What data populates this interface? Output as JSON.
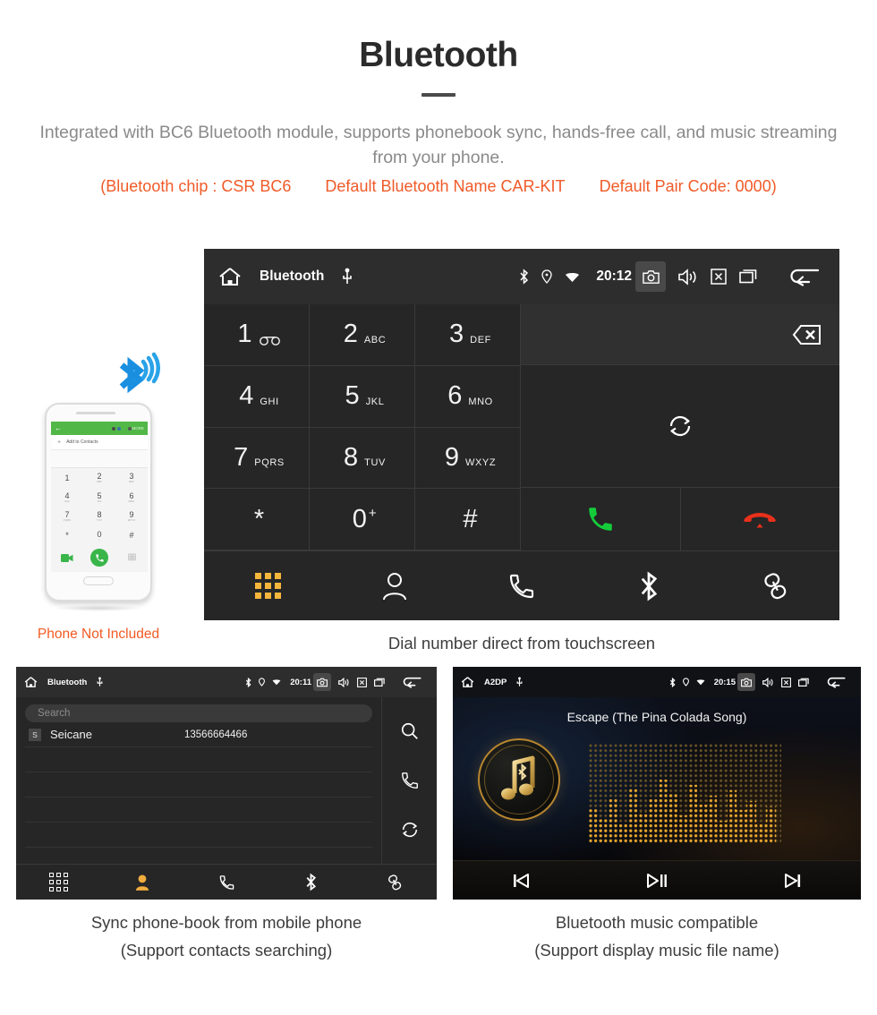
{
  "header": {
    "title": "Bluetooth",
    "subtitle": "Integrated with BC6 Bluetooth module, supports phonebook sync, hands-free call, and music streaming from your phone.",
    "spec_chip": "(Bluetooth chip : CSR BC6",
    "spec_name": "Default Bluetooth Name CAR-KIT",
    "spec_pair": "Default Pair Code: 0000)",
    "accent_color": "#f05a28"
  },
  "main_unit": {
    "statusbar": {
      "home_icon": "home-icon",
      "title": "Bluetooth",
      "usb_icon": "usb-icon",
      "bluetooth_icon": "bluetooth-icon",
      "location_icon": "location-icon",
      "wifi_icon": "wifi-icon",
      "time": "20:12",
      "camera_icon": "camera-icon",
      "volume_icon": "volume-icon",
      "close_icon": "close-box-icon",
      "recents_icon": "recents-icon",
      "back_icon": "back-arrow-icon"
    },
    "keys": [
      {
        "num": "1",
        "sub": "",
        "voicemail": true
      },
      {
        "num": "2",
        "sub": "ABC"
      },
      {
        "num": "3",
        "sub": "DEF"
      },
      {
        "num": "4",
        "sub": "GHI"
      },
      {
        "num": "5",
        "sub": "JKL"
      },
      {
        "num": "6",
        "sub": "MNO"
      },
      {
        "num": "7",
        "sub": "PQRS"
      },
      {
        "num": "8",
        "sub": "TUV"
      },
      {
        "num": "9",
        "sub": "WXYZ"
      },
      {
        "num": "*",
        "sub": ""
      },
      {
        "num": "0",
        "sub": "+",
        "sup": true
      },
      {
        "num": "#",
        "sub": ""
      }
    ],
    "input_value": "",
    "backspace_icon": "backspace-icon",
    "sync_icon": "sync-icon",
    "call_icon": "call-green-icon",
    "hangup_icon": "hangup-red-icon",
    "tabs": [
      {
        "icon": "keypad-icon",
        "active": true
      },
      {
        "icon": "contacts-icon",
        "active": false
      },
      {
        "icon": "call-history-icon",
        "active": false
      },
      {
        "icon": "bluetooth-icon",
        "active": false
      },
      {
        "icon": "pair-link-icon",
        "active": false
      }
    ],
    "caption": "Dial number direct from touchscreen"
  },
  "phone_mock": {
    "bluetooth_badge_icon": "bluetooth-signal-icon",
    "app_back_icon": "back-arrow-icon",
    "app_more_label": "MORE",
    "add_contact_label": "Add to Contacts",
    "keys": [
      {
        "num": "1",
        "sub": ""
      },
      {
        "num": "2",
        "sub": "ABC"
      },
      {
        "num": "3",
        "sub": "DEF"
      },
      {
        "num": "4",
        "sub": "GHI"
      },
      {
        "num": "5",
        "sub": "JKL"
      },
      {
        "num": "6",
        "sub": "MNO"
      },
      {
        "num": "7",
        "sub": "PQRS"
      },
      {
        "num": "8",
        "sub": "TUV"
      },
      {
        "num": "9",
        "sub": "WXYZ"
      },
      {
        "num": "*",
        "sub": ""
      },
      {
        "num": "0",
        "sub": "+"
      },
      {
        "num": "#",
        "sub": ""
      }
    ],
    "video_call_icon": "video-call-icon",
    "call_icon": "call-green-icon",
    "keypad_toggle_icon": "keypad-icon",
    "disclaimer": "Phone Not Included",
    "disclaimer_color": "#f15a22"
  },
  "contacts_unit": {
    "statusbar": {
      "home_icon": "home-icon",
      "title": "Bluetooth",
      "usb_icon": "usb-icon",
      "time": "20:11",
      "camera_icon": "camera-icon",
      "volume_icon": "volume-icon",
      "close_icon": "close-box-icon",
      "recents_icon": "recents-icon",
      "back_icon": "back-arrow-icon"
    },
    "search_placeholder": "Search",
    "contacts": [
      {
        "initial": "S",
        "name": "Seicane",
        "number": "13566664466"
      }
    ],
    "empty_rows": 4,
    "side_actions": [
      {
        "icon": "search-icon"
      },
      {
        "icon": "call-icon"
      },
      {
        "icon": "sync-icon"
      }
    ],
    "tabs": [
      {
        "icon": "keypad-icon",
        "active": false
      },
      {
        "icon": "contacts-icon",
        "active": true
      },
      {
        "icon": "call-history-icon",
        "active": false
      },
      {
        "icon": "bluetooth-icon",
        "active": false
      },
      {
        "icon": "pair-link-icon",
        "active": false
      }
    ],
    "caption_line1": "Sync phone-book from mobile phone",
    "caption_line2": "(Support contacts searching)"
  },
  "music_unit": {
    "statusbar": {
      "home_icon": "home-icon",
      "title": "A2DP",
      "usb_icon": "usb-icon",
      "time": "20:15",
      "camera_icon": "camera-icon",
      "volume_icon": "volume-icon",
      "close_icon": "close-box-icon",
      "recents_icon": "recents-icon",
      "back_icon": "back-arrow-icon"
    },
    "song_title": "Escape (The Pina Colada Song)",
    "album_icon": "bluetooth-music-note-icon",
    "equalizer_icon": "dot-matrix-equalizer",
    "controls": [
      {
        "icon": "previous-track-icon"
      },
      {
        "icon": "play-pause-icon"
      },
      {
        "icon": "next-track-icon"
      }
    ],
    "caption_line1": "Bluetooth music compatible",
    "caption_line2": "(Support display music file name)"
  }
}
